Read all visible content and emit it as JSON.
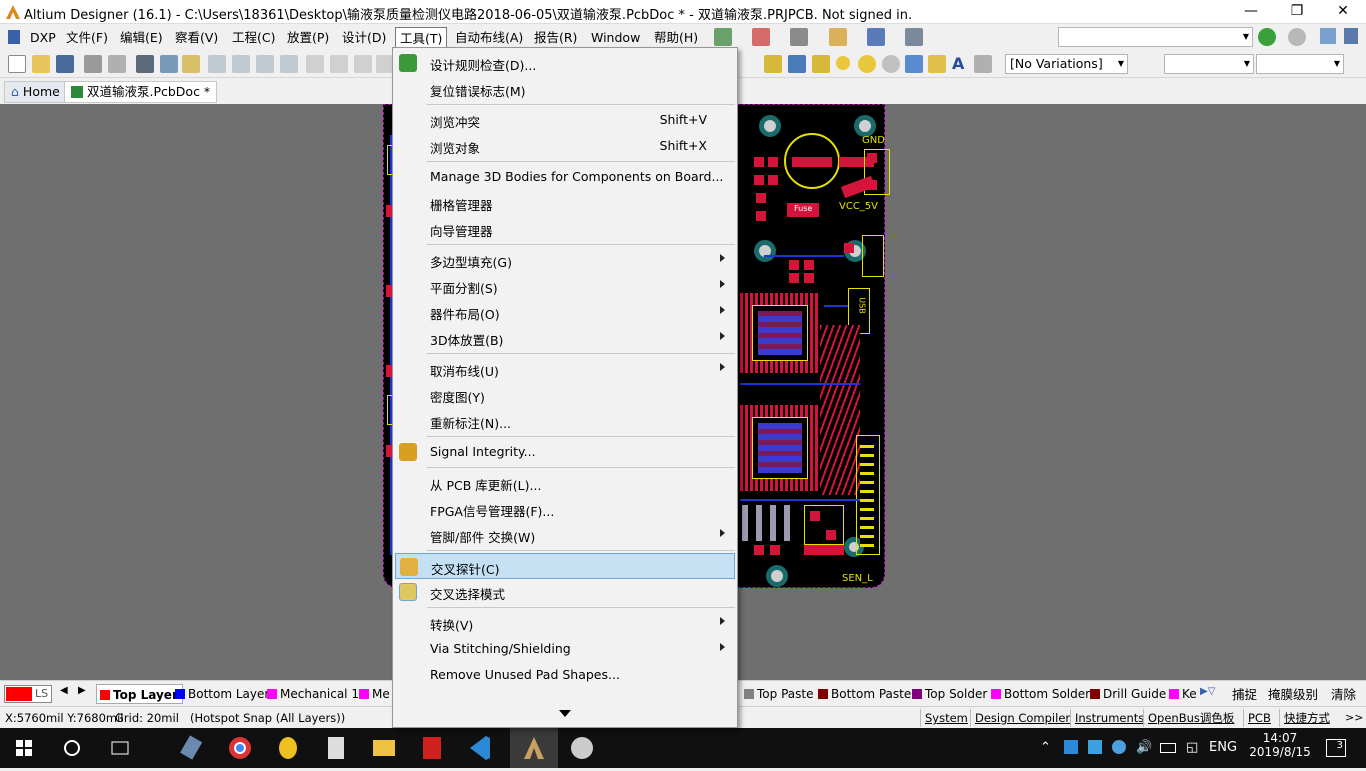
{
  "window": {
    "title": "Altium Designer (16.1) - C:\\Users\\18361\\Desktop\\输液泵质量检测仪电路2018-06-05\\双道输液泵.PcbDoc * - 双道输液泵.PRJPCB. Not signed in."
  },
  "menu": [
    "DXP",
    "文件(F)",
    "编辑(E)",
    "察看(V)",
    "工程(C)",
    "放置(P)",
    "设计(D)",
    "工具(T)",
    "自动布线(A)",
    "报告(R)",
    "Window",
    "帮助(H)"
  ],
  "toolbar": {
    "variations": "[No Variations]"
  },
  "tabs": {
    "home": "Home",
    "doc": "双道输液泵.PcbDoc *"
  },
  "tools_menu": {
    "items": [
      {
        "label": "设计规则检查(D)...",
        "shortcut": "",
        "submenu": false
      },
      {
        "label": "复位错误标志(M)",
        "shortcut": "",
        "submenu": false
      },
      {
        "label": "浏览冲突",
        "shortcut": "Shift+V",
        "submenu": false
      },
      {
        "label": "浏览对象",
        "shortcut": "Shift+X",
        "submenu": false
      },
      {
        "label": "Manage 3D Bodies for Components on Board...",
        "shortcut": "",
        "submenu": false
      },
      {
        "label": "栅格管理器",
        "shortcut": "",
        "submenu": false
      },
      {
        "label": "向导管理器",
        "shortcut": "",
        "submenu": false
      },
      {
        "label": "多边型填充(G)",
        "shortcut": "",
        "submenu": true
      },
      {
        "label": "平面分割(S)",
        "shortcut": "",
        "submenu": true
      },
      {
        "label": "器件布局(O)",
        "shortcut": "",
        "submenu": true
      },
      {
        "label": "3D体放置(B)",
        "shortcut": "",
        "submenu": true
      },
      {
        "label": "取消布线(U)",
        "shortcut": "",
        "submenu": true
      },
      {
        "label": "密度图(Y)",
        "shortcut": "",
        "submenu": false
      },
      {
        "label": "重新标注(N)...",
        "shortcut": "",
        "submenu": false
      },
      {
        "label": "Signal Integrity...",
        "shortcut": "",
        "submenu": false
      },
      {
        "label": "从 PCB 库更新(L)...",
        "shortcut": "",
        "submenu": false
      },
      {
        "label": "FPGA信号管理器(F)...",
        "shortcut": "",
        "submenu": false
      },
      {
        "label": "管脚/部件 交换(W)",
        "shortcut": "",
        "submenu": true
      },
      {
        "label": "交叉探针(C)",
        "shortcut": "",
        "submenu": false
      },
      {
        "label": "交叉选择模式",
        "shortcut": "",
        "submenu": false
      },
      {
        "label": "转换(V)",
        "shortcut": "",
        "submenu": true
      },
      {
        "label": "Via Stitching/Shielding",
        "shortcut": "",
        "submenu": true
      },
      {
        "label": "Remove Unused Pad Shapes...",
        "shortcut": "",
        "submenu": false
      }
    ]
  },
  "pcb": {
    "labels": {
      "gnd": "GND",
      "vcc": "VCC_5V",
      "sen": "SEN_L",
      "fuse": "Fuse",
      "usb": "USB"
    }
  },
  "layers": {
    "current": "LS",
    "tabs": [
      {
        "name": "Top Layer",
        "color": "#ff0000"
      },
      {
        "name": "Bottom Layer",
        "color": "#0000ff"
      },
      {
        "name": "Mechanical 1",
        "color": "#ff00ff"
      },
      {
        "name": "Me",
        "color": "#ff00ff"
      },
      {
        "name": "Top Paste",
        "color": "#808080"
      },
      {
        "name": "Bottom Paste",
        "color": "#800000"
      },
      {
        "name": "Top Solder",
        "color": "#800080"
      },
      {
        "name": "Bottom Solder",
        "color": "#ff00ff"
      },
      {
        "name": "Drill Guide",
        "color": "#800000"
      },
      {
        "name": "Ke",
        "color": "#ff00ff"
      }
    ],
    "buttons": [
      "捕捉",
      "掩膜级别",
      "清除"
    ]
  },
  "status": {
    "coords": "X:5760mil Y:7680mil",
    "grid": "Grid: 20mil",
    "snap": "(Hotspot Snap (All Layers))",
    "panels": [
      "System",
      "Design Compiler",
      "Instruments",
      "OpenBus调色板",
      "PCB",
      "快捷方式"
    ]
  },
  "taskbar": {
    "ime": "ENG",
    "time": "14:07",
    "date": "2019/8/15",
    "notif": "3"
  }
}
